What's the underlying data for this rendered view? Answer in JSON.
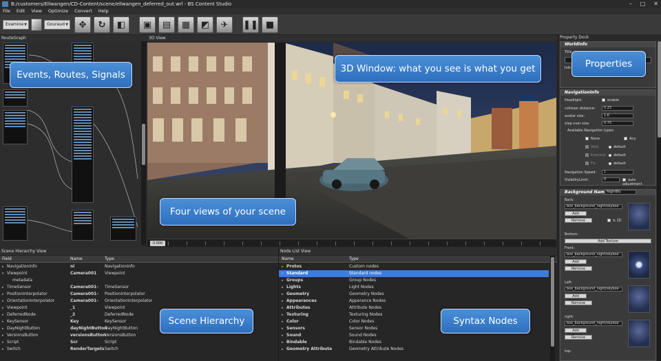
{
  "window": {
    "title": "B:/customers/Ellwangen/CD-Content/scene/ellwangen_deferred_out.wrl - BS Content Studio",
    "buttons": [
      "–",
      "□",
      "✕"
    ]
  },
  "menu": [
    "File",
    "Edit",
    "View",
    "Optimize",
    "Convert",
    "Help"
  ],
  "toolbar": {
    "mode_value": "Examine",
    "shading_value": "Gouraud",
    "icons": [
      "move-icon",
      "rotate-icon",
      "fit-icon",
      "nav1-icon",
      "nav2-icon",
      "nav3-icon",
      "nav4-icon",
      "nav5-icon",
      "pause-icon",
      "stop-icon"
    ]
  },
  "panels": {
    "routegraph_title": "RouteGraph",
    "view3d_title": "3D View",
    "propdock_title": "Property Dock",
    "scenehier_title": "Scene Hierarchy View",
    "nodelist_title": "Node List View"
  },
  "timeline": {
    "value": "0.000"
  },
  "callouts": {
    "events": "Events, Routes, Signals",
    "window3d": "3D Window: what you see is what you get",
    "properties": "Properties",
    "fourviews": "Four views of your scene",
    "scenehier": "Scene Hierarchy",
    "syntax": "Syntax Nodes"
  },
  "properties": {
    "worldinfo": {
      "header": "WorldInfo",
      "title_label": "Title",
      "info_label": "Info"
    },
    "navigation": {
      "header": "NavigationInfo",
      "headlight_label": "Headlight:",
      "headlight_value": "enable",
      "collision_label": "collision distance:",
      "collision_value": "0.25",
      "avatar_label": "avatar size:",
      "avatar_value": "1.6",
      "step_label": "step over size:",
      "step_value": "0.75",
      "types_label": "Available Navigation types:",
      "types": [
        {
          "name": "None",
          "checked": false
        },
        {
          "name": "Walk",
          "checked": false
        },
        {
          "name": "Examine",
          "checked": false
        },
        {
          "name": "Fly",
          "checked": false
        }
      ],
      "any_label": "Any",
      "default_label": "default",
      "speed_label": "Navigation Speed:",
      "speed_value": "1",
      "visibility_label": "VisibilityLimit:",
      "visibility_value": "0",
      "auto_label": "auto adjustment"
    },
    "background": {
      "header": "Background Name:",
      "name_value": "NightBG",
      "back_label": "Back:",
      "url_value": "box_background_night/skybox-",
      "add_fallback": "Add Fallback",
      "remove": "Remove",
      "is2d": "is 2D",
      "bottom_label": "Bottom:",
      "add_texture": "Add Texture",
      "front_label": "Front:",
      "left_label": "Left:",
      "right_label": "right:",
      "top_label": "top:"
    }
  },
  "scene_hierarchy": {
    "columns": [
      "Field",
      "Name",
      "Type"
    ],
    "rows": [
      {
        "field": "NavigationInfo",
        "name": "ni",
        "type": "NavigationInfo",
        "arrow": "▸",
        "indent": 0
      },
      {
        "field": "Viewpoint",
        "name": "Camera001",
        "type": "Viewpoint",
        "arrow": "▾",
        "indent": 0
      },
      {
        "field": "metadata",
        "name": "",
        "type": "",
        "arrow": "",
        "indent": 1
      },
      {
        "field": "TimeSensor",
        "name": "Camera001-",
        "type": "TimeSensor",
        "arrow": "▸",
        "indent": 0
      },
      {
        "field": "PositionInterpolator",
        "name": "Camera001-",
        "type": "PositionInterpolator",
        "arrow": "▸",
        "indent": 0
      },
      {
        "field": "OrientationInterpolator",
        "name": "Camera001-",
        "type": "OrientationInterpolator",
        "arrow": "▸",
        "indent": 0
      },
      {
        "field": "Viewpoint",
        "name": "_1",
        "type": "Viewpoint",
        "arrow": "▸",
        "indent": 0
      },
      {
        "field": "DeferredNode",
        "name": "_2",
        "type": "DeferredNode",
        "arrow": "▸",
        "indent": 0
      },
      {
        "field": "KeySensor",
        "name": "Key",
        "type": "KeySensor",
        "arrow": "▸",
        "indent": 0
      },
      {
        "field": "DayNightButton",
        "name": "dayNightButton",
        "type": "DayNightButton",
        "arrow": "▸",
        "indent": 0
      },
      {
        "field": "VersionsButton",
        "name": "versionsButton",
        "type": "VersionsButton",
        "arrow": "▸",
        "indent": 0
      },
      {
        "field": "Script",
        "name": "Scr",
        "type": "Script",
        "arrow": "▸",
        "indent": 0
      },
      {
        "field": "Switch",
        "name": "RenderTargets",
        "type": "Switch",
        "arrow": "▸",
        "indent": 0
      }
    ]
  },
  "node_list": {
    "columns": [
      "Name",
      "Type"
    ],
    "rows": [
      {
        "name": "Protos",
        "type": "Custom nodes",
        "arrow": "▸",
        "selected": false
      },
      {
        "name": "Standard",
        "type": "Standard nodes",
        "arrow": "▾",
        "selected": true
      },
      {
        "name": "Groups",
        "type": "Group Nodes",
        "arrow": "▸",
        "selected": false
      },
      {
        "name": "Lights",
        "type": "Light Nodes",
        "arrow": "▸",
        "selected": false
      },
      {
        "name": "Geometry",
        "type": "Geometry Nodes",
        "arrow": "▸",
        "selected": false
      },
      {
        "name": "Appearances",
        "type": "Apperance Nodes",
        "arrow": "▸",
        "selected": false
      },
      {
        "name": "Attributes",
        "type": "Attribute Nodes",
        "arrow": "▸",
        "selected": false
      },
      {
        "name": "Texturing",
        "type": "Texturing Nodes",
        "arrow": "▸",
        "selected": false
      },
      {
        "name": "Color",
        "type": "Color Nodes",
        "arrow": "▸",
        "selected": false
      },
      {
        "name": "Sensors",
        "type": "Sensor Nodes",
        "arrow": "▸",
        "selected": false
      },
      {
        "name": "Sound",
        "type": "Sound Nodes",
        "arrow": "▸",
        "selected": false
      },
      {
        "name": "Bindable",
        "type": "Bindable Nodes",
        "arrow": "▸",
        "selected": false
      },
      {
        "name": "Geometry Attribute",
        "type": "Geometry Attribute Nodes",
        "arrow": "▸",
        "selected": false
      }
    ]
  },
  "colors": {
    "accent": "#3a7ed6",
    "callout": "#3f83cf"
  }
}
